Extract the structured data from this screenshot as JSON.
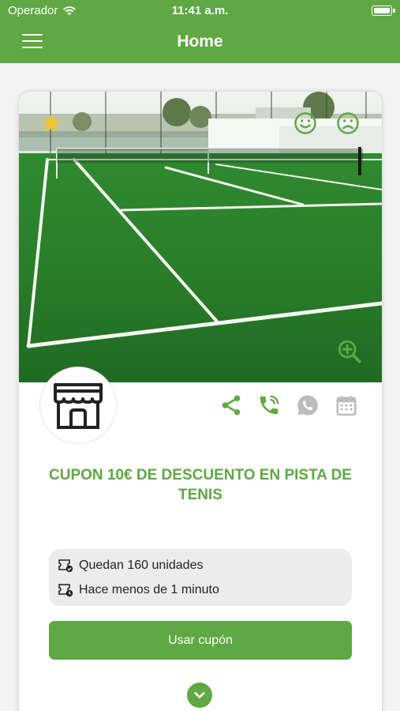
{
  "status_bar": {
    "carrier": "Operador",
    "time": "11:41 a.m.",
    "wifi_icon": "wifi-icon",
    "battery_icon": "battery-icon"
  },
  "nav": {
    "title": "Home",
    "menu_icon": "hamburger-menu-icon"
  },
  "colors": {
    "brand_green": "#5fa843",
    "text_dark": "#222222",
    "info_bg": "#ececec",
    "inactive_icon": "#bcbcbc",
    "star_yellow": "#f2c236"
  },
  "coupon": {
    "image_icons": [
      "star-icon",
      "smile-icon",
      "sad-face-icon",
      "zoom-in-icon"
    ],
    "actions": [
      {
        "name": "share-icon",
        "active": true
      },
      {
        "name": "phone-icon",
        "active": true
      },
      {
        "name": "whatsapp-icon",
        "active": false
      },
      {
        "name": "calendar-icon",
        "active": false
      }
    ],
    "title": "CUPON 10€  DE DESCUENTO EN PISTA DE TENIS",
    "remaining": "Quedan 160 unidades",
    "posted": "Hace menos de 1 minuto",
    "button_label": "Usar cupón",
    "expand_icon": "chevron-down-icon"
  }
}
